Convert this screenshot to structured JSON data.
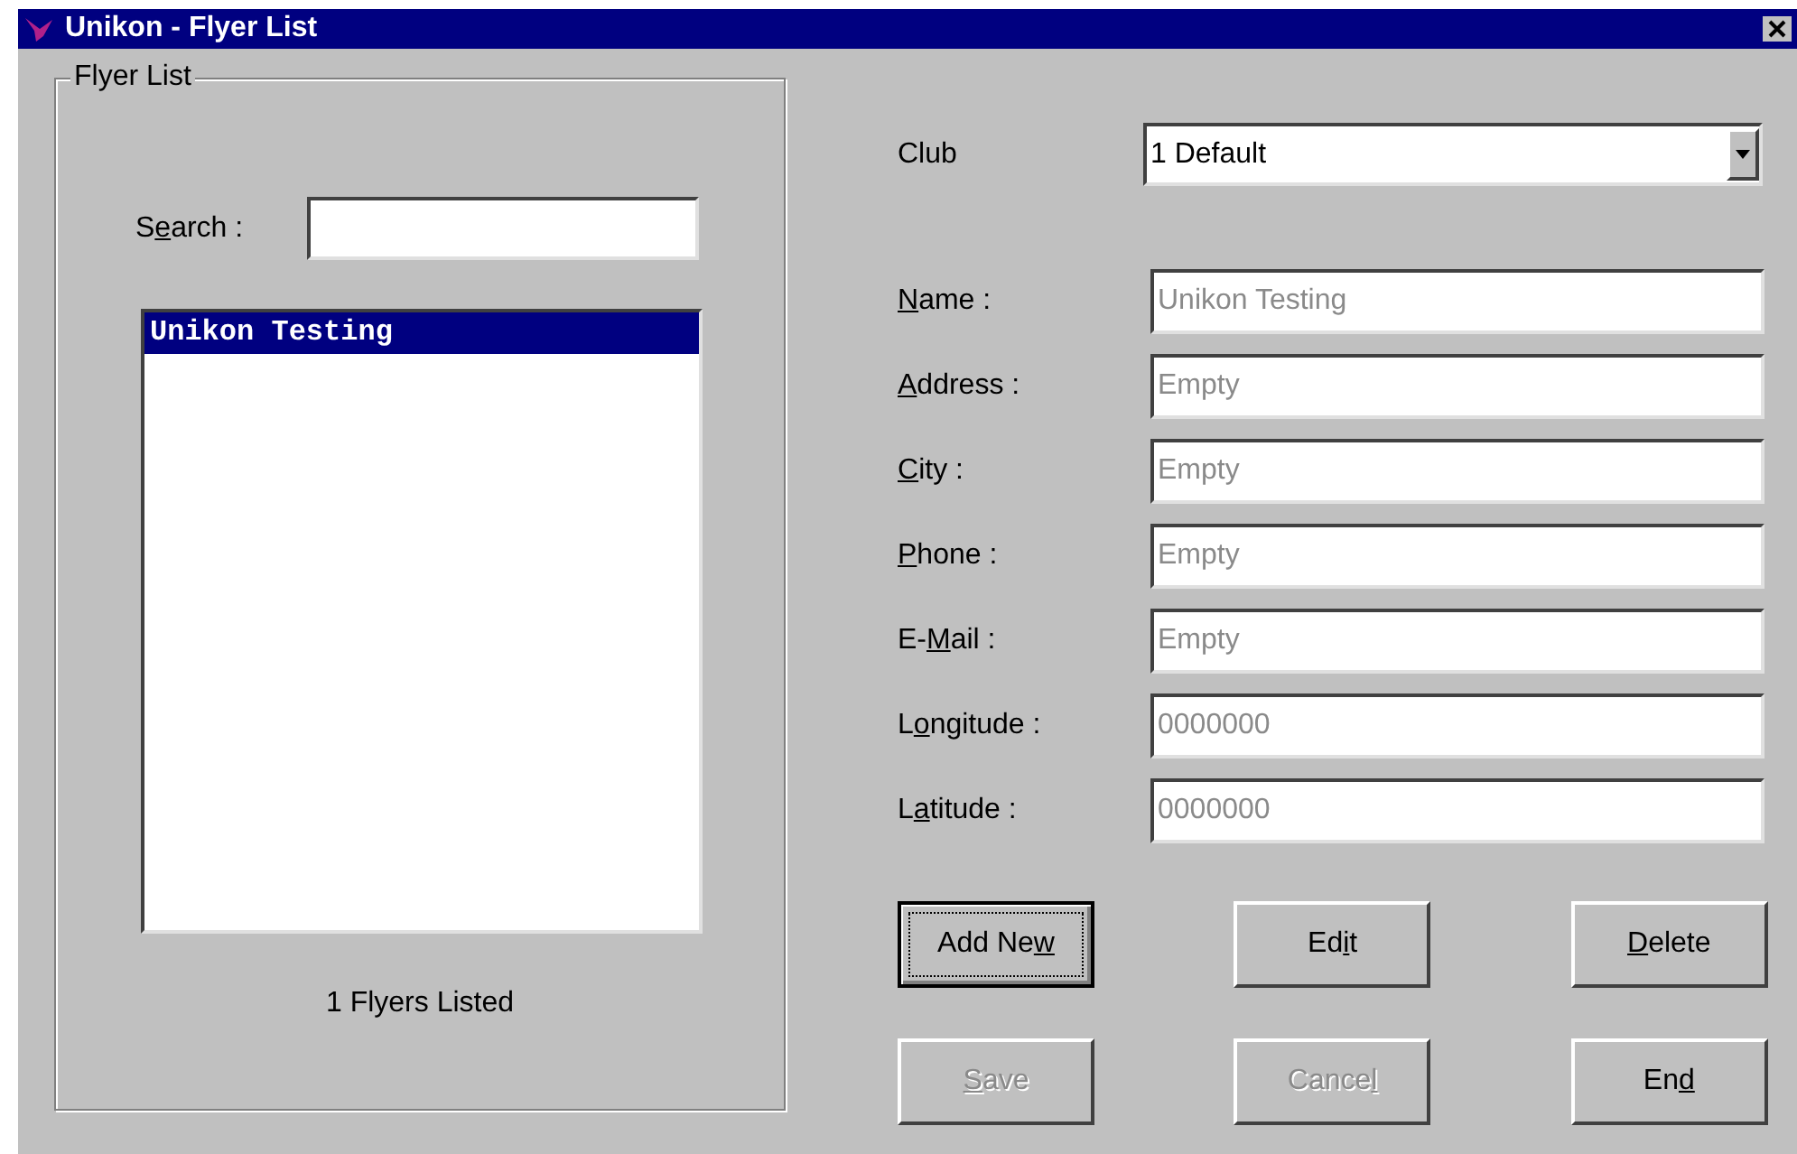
{
  "window": {
    "title": "Unikon - Flyer List"
  },
  "flyer_list": {
    "title": "Flyer List",
    "search": {
      "label": {
        "pre": "S",
        "key": "e",
        "post": "arch :"
      }
    },
    "items": [
      {
        "text": "Unikon Testing",
        "selected": true
      }
    ],
    "count": "1 Flyers Listed"
  },
  "club": {
    "label": {
      "pre": "Club"
    },
    "value": "1 Default"
  },
  "fields": [
    {
      "label": {
        "key": "N",
        "post": "ame :"
      },
      "value": "Unikon Testing",
      "disabled": true
    },
    {
      "label": {
        "key": "A",
        "post": "ddress :"
      },
      "value": "Empty",
      "disabled": true
    },
    {
      "label": {
        "key": "C",
        "post": "ity :"
      },
      "value": "Empty",
      "disabled": true
    },
    {
      "label": {
        "key": "P",
        "post": "hone :"
      },
      "value": "Empty",
      "disabled": true
    },
    {
      "label": {
        "pre": "E-",
        "key": "M",
        "post": "ail :"
      },
      "value": "Empty",
      "disabled": true
    },
    {
      "label": {
        "pre": "L",
        "key": "o",
        "post": "ngitude :"
      },
      "value": "0000000",
      "disabled": true
    },
    {
      "label": {
        "pre": "L",
        "key": "a",
        "post": "titude :"
      },
      "value": "0000000",
      "disabled": true
    }
  ],
  "buttons": [
    {
      "label": {
        "pre": "Add Ne",
        "key": "w"
      },
      "disabled": false,
      "focused": true
    },
    {
      "label": {
        "pre": "Ed",
        "key": "i",
        "post": "t"
      },
      "disabled": false,
      "focused": false
    },
    {
      "label": {
        "key": "D",
        "post": "elete"
      },
      "disabled": false,
      "focused": false
    },
    {
      "label": {
        "key": "S",
        "post": "ave"
      },
      "disabled": true,
      "focused": false
    },
    {
      "label": {
        "pre": "Cance",
        "key": "l"
      },
      "disabled": true,
      "focused": false
    },
    {
      "label": {
        "pre": "En",
        "key": "d"
      },
      "disabled": false,
      "focused": false
    }
  ]
}
